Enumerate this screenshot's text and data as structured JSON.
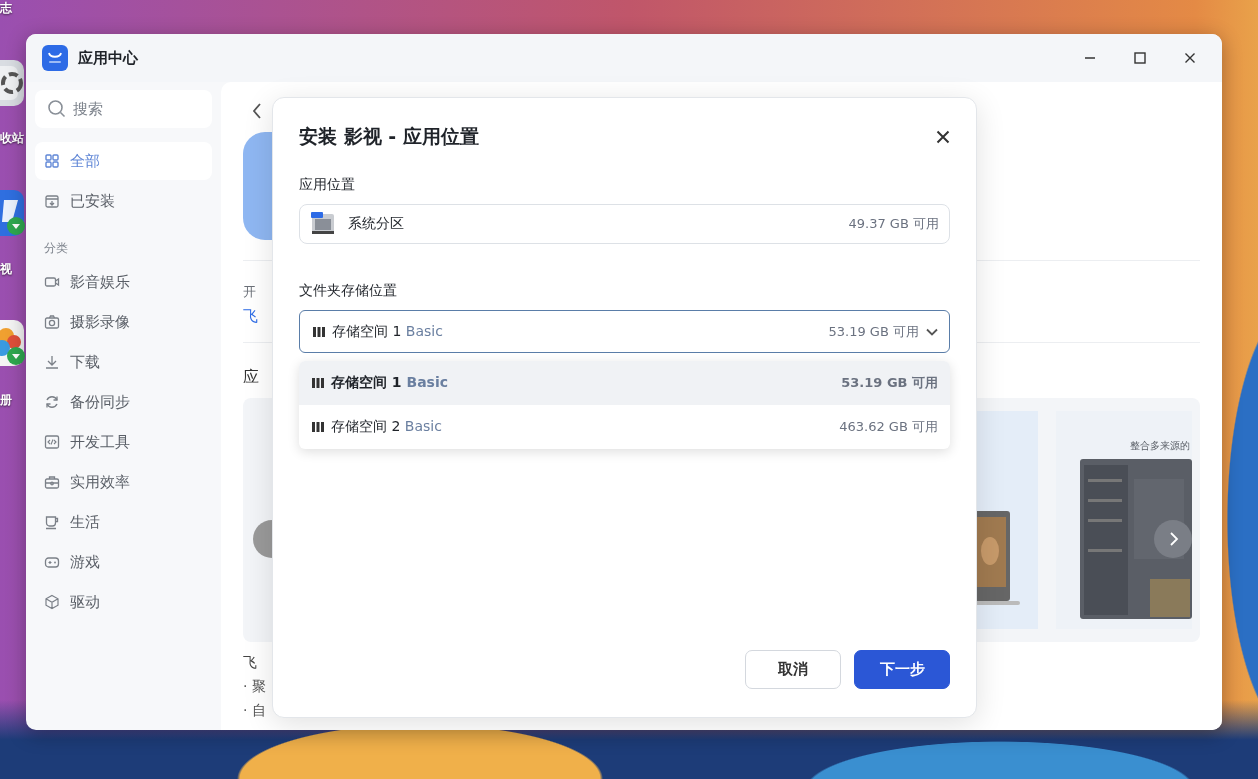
{
  "desktop": {
    "icons": [
      {
        "kind": "none",
        "label": "志"
      },
      {
        "kind": "recycle",
        "label": "收站"
      },
      {
        "kind": "video",
        "label": "视"
      },
      {
        "kind": "photos",
        "label": "册"
      }
    ]
  },
  "window": {
    "title": "应用中心"
  },
  "sidebar": {
    "search": {
      "placeholder": "搜索"
    },
    "items": [
      {
        "label": "全部",
        "selected": true
      },
      {
        "label": "已安装",
        "selected": false
      }
    ],
    "section_label": "分类",
    "categories": [
      {
        "label": "影音娱乐",
        "selected": false
      },
      {
        "label": "摄影录像",
        "selected": false
      },
      {
        "label": "下载",
        "selected": false
      },
      {
        "label": "备份同步",
        "selected": false
      },
      {
        "label": "开发工具",
        "selected": false
      },
      {
        "label": "实用效率",
        "selected": false
      },
      {
        "label": "生活",
        "selected": false
      },
      {
        "label": "游戏",
        "selected": false
      },
      {
        "label": "驱动",
        "selected": false
      }
    ]
  },
  "app_page": {
    "developer_label": "开",
    "developer": "飞",
    "section_title": "应",
    "carousel_caption": "整合多来源的",
    "description_title": "飞",
    "bullets": [
      "· 聚",
      "· 自"
    ]
  },
  "dialog": {
    "title": "安装 影视 - 应用位置",
    "app_location": {
      "label": "应用位置",
      "value": "系统分区",
      "free": "49.37 GB 可用"
    },
    "folder_location": {
      "label": "文件夹存储位置",
      "value": "存储空间 1",
      "tier": "Basic",
      "free": "53.19 GB 可用",
      "expanded": true,
      "options": [
        {
          "name": "存储空间 1",
          "tier": "Basic",
          "free": "53.19 GB 可用",
          "selected": true
        },
        {
          "name": "存储空间 2",
          "tier": "Basic",
          "free": "463.62 GB 可用",
          "selected": false
        }
      ]
    },
    "buttons": [
      {
        "label": "取消",
        "kind": "secondary"
      },
      {
        "label": "下一步",
        "kind": "primary"
      }
    ]
  }
}
